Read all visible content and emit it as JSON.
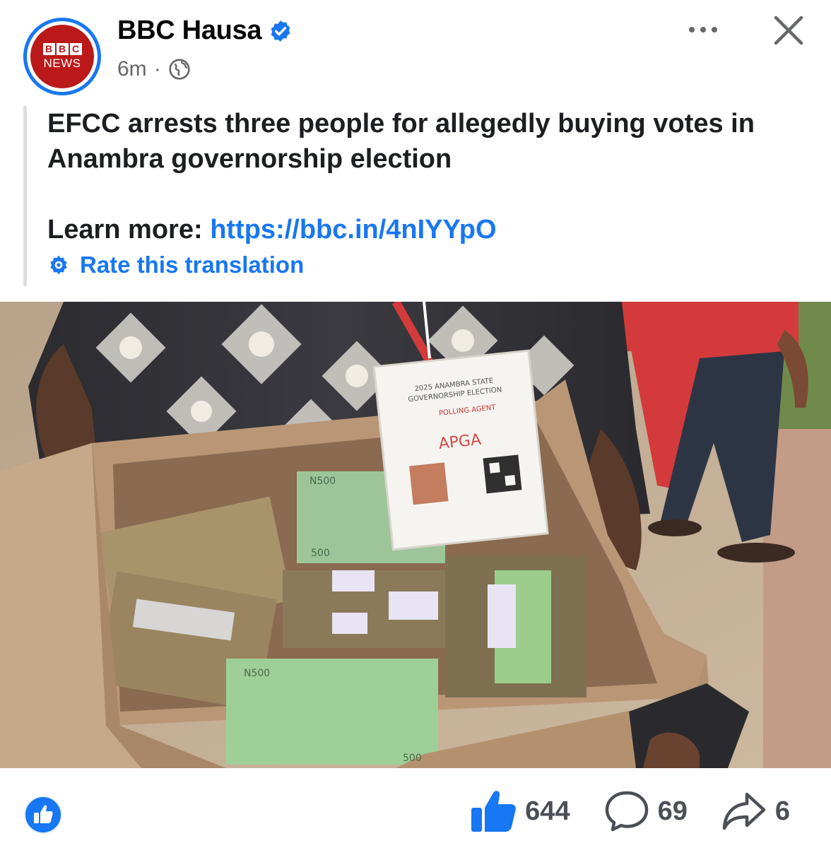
{
  "header": {
    "page_name": "BBC Hausa",
    "avatar_top": "BBC",
    "avatar_letters": [
      "B",
      "B",
      "C"
    ],
    "avatar_bottom": "NEWS",
    "time": "6m",
    "separator": "·",
    "icons": {
      "verified": "verified-badge-icon",
      "privacy": "globe-icon",
      "more": "more-options-icon",
      "close": "close-icon"
    }
  },
  "post": {
    "headline": "EFCC arrests three people for allegedly buying votes in Anambra governorship election",
    "learn_more_label": "Learn more:",
    "link": "https://bbc.in/4nIYYpO",
    "rate_translation": "Rate this translation"
  },
  "image": {
    "badge_lines": [
      "2025 ANAMBRA STATE",
      "GOVERNORSHIP ELECTION",
      "POLLING AGENT"
    ],
    "badge_party": "APGA",
    "note_labels": [
      "N500",
      "500",
      "N500",
      "500"
    ]
  },
  "footer": {
    "likes": "644",
    "comments": "69",
    "shares": "6"
  },
  "colors": {
    "accent": "#1877f2",
    "bbc_red": "#bb1919",
    "muted": "#65676b"
  }
}
